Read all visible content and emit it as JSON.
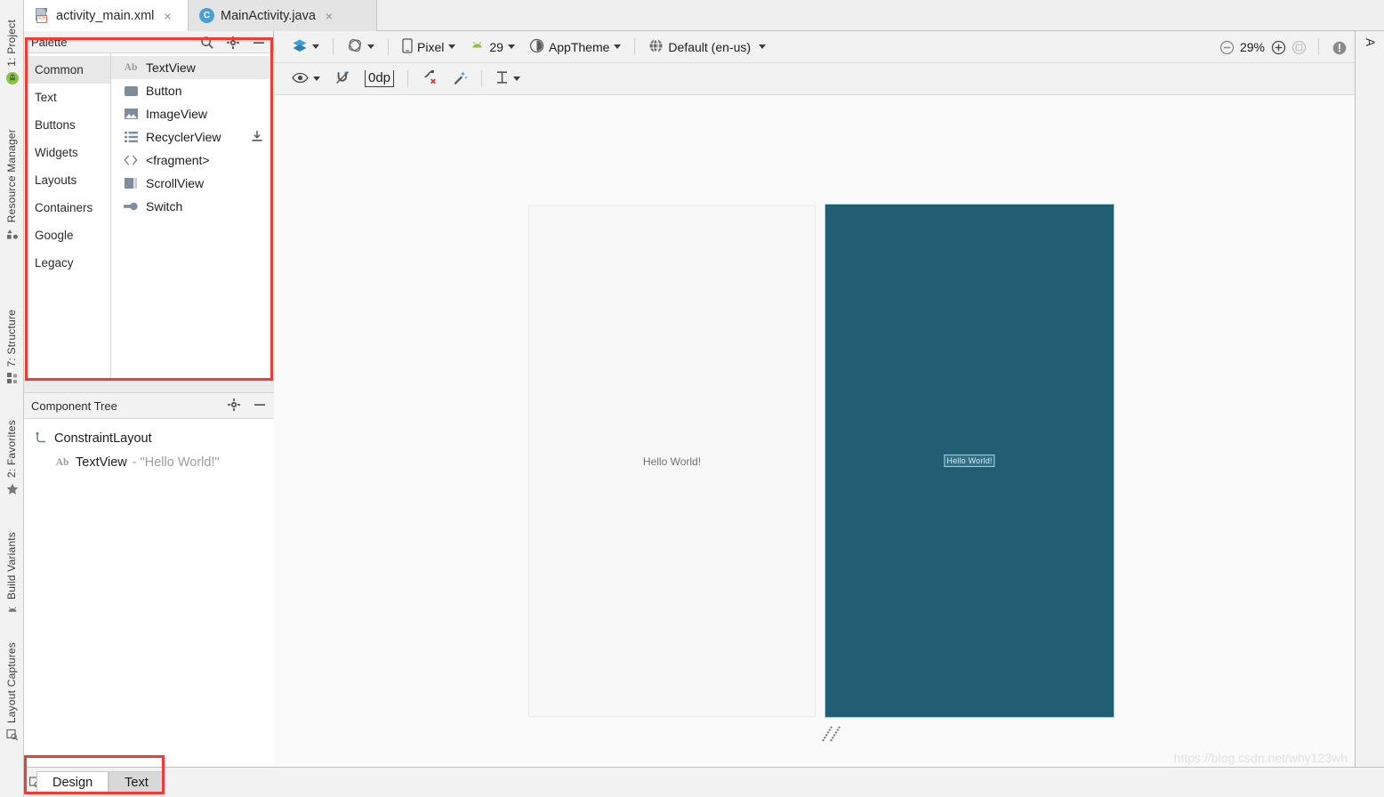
{
  "window": {
    "watermark": "https://blog.csdn.net/why123wh"
  },
  "left_strip": {
    "items": [
      {
        "label": "1: Project",
        "icon": "project-icon"
      },
      {
        "label": "Resource Manager",
        "icon": "resource-manager-icon"
      },
      {
        "label": "7: Structure",
        "icon": "structure-icon"
      },
      {
        "label": "2: Favorites",
        "icon": "star-icon"
      },
      {
        "label": "Build Variants",
        "icon": "android-icon"
      },
      {
        "label": "Layout Captures",
        "icon": "layout-captures-icon"
      }
    ]
  },
  "editor_tabs": [
    {
      "label": "activity_main.xml",
      "icon": "xml-file-icon",
      "active": true,
      "close": "×"
    },
    {
      "label": "MainActivity.java",
      "icon": "java-class-icon",
      "active": false,
      "close": "×"
    }
  ],
  "palette": {
    "title": "Palette",
    "search_icon": "search-icon",
    "settings_icon": "gear-icon",
    "minimize_icon": "minimize-icon",
    "categories": [
      {
        "label": "Common",
        "selected": true
      },
      {
        "label": "Text",
        "selected": false
      },
      {
        "label": "Buttons",
        "selected": false
      },
      {
        "label": "Widgets",
        "selected": false
      },
      {
        "label": "Layouts",
        "selected": false
      },
      {
        "label": "Containers",
        "selected": false
      },
      {
        "label": "Google",
        "selected": false
      },
      {
        "label": "Legacy",
        "selected": false
      }
    ],
    "items": [
      {
        "label": "TextView",
        "icon": "textview-icon",
        "selected": true,
        "download": false
      },
      {
        "label": "Button",
        "icon": "button-icon",
        "selected": false,
        "download": false
      },
      {
        "label": "ImageView",
        "icon": "imageview-icon",
        "selected": false,
        "download": false
      },
      {
        "label": "RecyclerView",
        "icon": "recyclerview-icon",
        "selected": false,
        "download": true
      },
      {
        "label": "<fragment>",
        "icon": "fragment-icon",
        "selected": false,
        "download": false
      },
      {
        "label": "ScrollView",
        "icon": "scrollview-icon",
        "selected": false,
        "download": false
      },
      {
        "label": "Switch",
        "icon": "switch-icon",
        "selected": false,
        "download": false
      }
    ]
  },
  "component_tree": {
    "title": "Component Tree",
    "settings_icon": "gear-icon",
    "minimize_icon": "minimize-icon",
    "nodes": [
      {
        "label": "ConstraintLayout",
        "value": "",
        "icon": "constraintlayout-icon"
      },
      {
        "label": "TextView",
        "value": "- \"Hello World!\"",
        "icon": "textview-icon"
      }
    ]
  },
  "toolbar": {
    "design_mode_icon": "layers-icon",
    "orientation_icon": "rotate-icon",
    "device": "Pixel",
    "device_icon": "phone-icon",
    "api_level": "29",
    "api_icon": "android-icon",
    "theme": "AppTheme",
    "theme_icon": "theme-icon",
    "locale": "Default (en-us)",
    "locale_icon": "globe-icon",
    "zoom_out_icon": "zoom-out-icon",
    "zoom_level": "29%",
    "zoom_in_icon": "zoom-in-icon",
    "zoom_fit_icon": "zoom-to-fit-icon",
    "issues_icon": "warning-icon"
  },
  "toolbar2": {
    "view_options_icon": "eye-icon",
    "autoconnect_icon": "autoconnect-off-icon",
    "default_margin": "0dp",
    "clear_constraints_icon": "clear-constraints-icon",
    "infer_constraints_icon": "infer-constraints-icon",
    "guidelines_icon": "guidelines-icon"
  },
  "canvas": {
    "design_preview_text": "Hello World!",
    "blueprint_preview_text": "Hello World!",
    "blueprint_color": "#215e73",
    "blueprint_border_color": "#9fd3e3",
    "design_bg_color": "#f8f8f8",
    "resize_handle_icon": "resize-handle-icon"
  },
  "right_panel": {
    "label": "A"
  },
  "bottom": {
    "tabs": [
      {
        "label": "Design",
        "active": true
      },
      {
        "label": "Text",
        "active": false
      }
    ],
    "strip_icon": "layout-inspector-icon"
  },
  "annotations": {
    "accent_color": "#f23b34"
  }
}
